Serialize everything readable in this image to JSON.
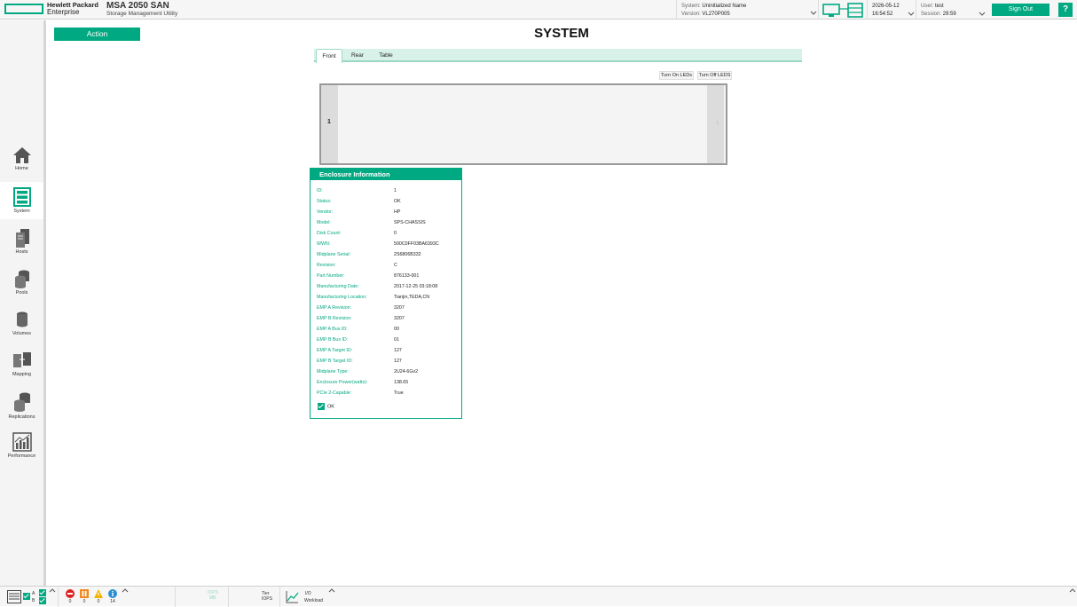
{
  "header": {
    "brand_line1": "Hewlett Packard",
    "brand_line2": "Enterprise",
    "product_title": "MSA 2050 SAN",
    "product_subtitle": "Storage Management Utility",
    "system_label": "System:",
    "system_value": "Uninitialized Name",
    "version_label": "Version:",
    "version_value": "VL270P005",
    "date": "2026-05-12",
    "time": "16:54:52",
    "user_label": "User:",
    "user_value": "test",
    "session_label": "Session:",
    "session_value": "29:59",
    "sign_out_label": "Sign Out",
    "help_label": "?"
  },
  "sidebar": {
    "items": [
      {
        "label": "Home",
        "icon": "home-icon"
      },
      {
        "label": "System",
        "icon": "system-icon"
      },
      {
        "label": "Hosts",
        "icon": "hosts-icon"
      },
      {
        "label": "Pools",
        "icon": "pools-icon"
      },
      {
        "label": "Volumes",
        "icon": "volumes-icon"
      },
      {
        "label": "Mapping",
        "icon": "mapping-icon"
      },
      {
        "label": "Replications",
        "icon": "replications-icon"
      },
      {
        "label": "Performance",
        "icon": "performance-icon"
      }
    ],
    "active": "System"
  },
  "main": {
    "action_label": "Action",
    "page_title": "SYSTEM",
    "tabs": [
      {
        "label": "Front"
      },
      {
        "label": "Rear"
      },
      {
        "label": "Table"
      }
    ],
    "active_tab": "Front",
    "led_on_label": "Turn On LEDs",
    "led_off_label": "Turn Off LEDS",
    "enclosure_id": "1",
    "enclosure_right_label": "1"
  },
  "enclosure_info": {
    "title": "Enclosure Information",
    "rows": [
      {
        "key": "ID:",
        "value": "1"
      },
      {
        "key": "Status:",
        "value": "OK"
      },
      {
        "key": "Vendor:",
        "value": "HP"
      },
      {
        "key": "Model:",
        "value": "SPS-CHASSIS"
      },
      {
        "key": "Disk Count:",
        "value": "0"
      },
      {
        "key": "WWN:",
        "value": "500C0FF03BA6393C"
      },
      {
        "key": "Midplane Serial:",
        "value": "2S6806B332"
      },
      {
        "key": "Revision:",
        "value": "C"
      },
      {
        "key": "Part Number:",
        "value": "876133-001"
      },
      {
        "key": "Manufacturing Date:",
        "value": "2017-12-25 03:18:08"
      },
      {
        "key": "Manufacturing Location:",
        "value": "Tianjin,TEDA,CN"
      },
      {
        "key": "EMP A Revision:",
        "value": "3207"
      },
      {
        "key": "EMP B Revision:",
        "value": "3207"
      },
      {
        "key": "EMP A Bus ID:",
        "value": "00"
      },
      {
        "key": "EMP B Bus ID:",
        "value": "01"
      },
      {
        "key": "EMP A Target ID:",
        "value": "127"
      },
      {
        "key": "EMP B Target ID:",
        "value": "127"
      },
      {
        "key": "Midplane Type:",
        "value": "2U24-6Gv2"
      },
      {
        "key": "Enclosure Power(watts):",
        "value": "138.65"
      },
      {
        "key": "PCIe 2-Capable:",
        "value": "True"
      }
    ],
    "health_label": "OK"
  },
  "footer": {
    "controller_a": "A",
    "controller_b": "B",
    "critical_count": "0",
    "error_count": "0",
    "warning_count": "0",
    "info_count": "14",
    "iops_label": "IOPS",
    "mb_label": "MB",
    "tier_label_1": "Tier",
    "tier_label_2": "IOPS",
    "io_label_1": "I/O",
    "io_label_2": "Workload"
  },
  "colors": {
    "accent": "#01a982",
    "tab_bg": "#d8f2ea",
    "critical": "#e02020",
    "error": "#f08a24",
    "warning": "#f5b400",
    "info": "#2d8ecf"
  }
}
